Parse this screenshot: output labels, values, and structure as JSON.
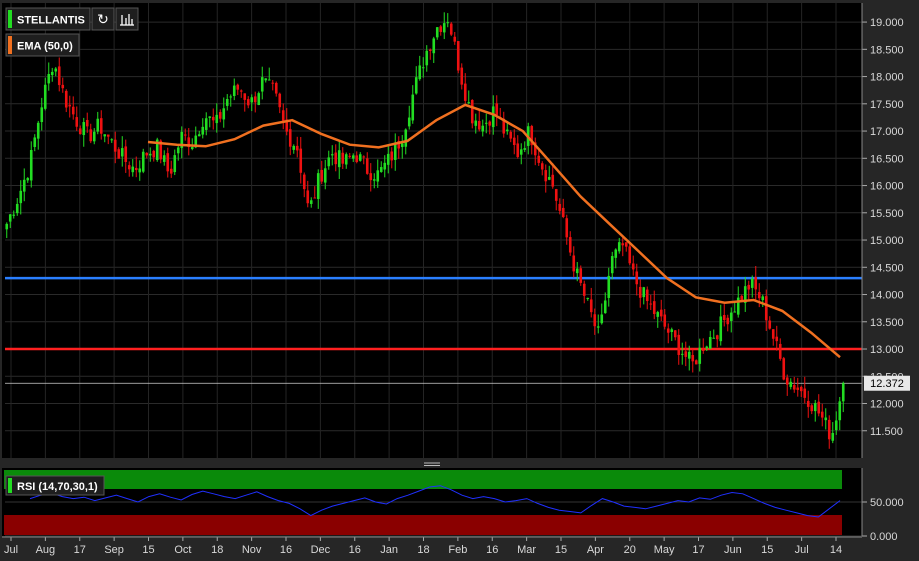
{
  "header": {
    "symbol": "STELLANTIS",
    "refresh_icon": "refresh-icon",
    "chart_type_icon": "bar-chart-icon"
  },
  "indicators": {
    "ema_label": "EMA (50,0)",
    "rsi_label": "RSI (14,70,30,1)"
  },
  "last_price_label": "12.372",
  "colors": {
    "background": "#000000",
    "frame": "#262626",
    "up_candle": "#22dd22",
    "down_candle": "#ee1111",
    "ema_line": "#f07020",
    "resistance_line": "#2a7fff",
    "support_line": "#ff2020",
    "rsi_line": "#2030ff",
    "rsi_overbought_zone": "#0a8a0a",
    "rsi_oversold_zone": "#8a0000"
  },
  "chart_data": [
    {
      "type": "candlestick",
      "title": "STELLANTIS",
      "ylim": [
        11.0,
        19.35
      ],
      "y_ticks": [
        "11.500",
        "12.000",
        "12.500",
        "13.000",
        "13.500",
        "14.000",
        "14.500",
        "15.000",
        "15.500",
        "16.000",
        "16.500",
        "17.000",
        "17.500",
        "18.000",
        "18.500",
        "19.000"
      ],
      "x_ticks": [
        "Jul",
        "Aug",
        "17",
        "Sep",
        "15",
        "Oct",
        "18",
        "Nov",
        "16",
        "Dec",
        "16",
        "Jan",
        "18",
        "Feb",
        "16",
        "Mar",
        "15",
        "Apr",
        "20",
        "May",
        "17",
        "Jun",
        "15",
        "Jul",
        "14"
      ],
      "horizontal_lines": [
        {
          "value": 14.3,
          "color": "#2a7fff"
        },
        {
          "value": 13.0,
          "color": "#ff2020"
        }
      ],
      "last_price": 12.372,
      "close_anchors": [
        15.3,
        15.8,
        16.4,
        17.5,
        18.3,
        17.6,
        17.2,
        16.9,
        17.1,
        16.8,
        16.5,
        16.3,
        16.6,
        16.7,
        16.2,
        16.9,
        16.8,
        17.3,
        17.1,
        17.6,
        17.8,
        17.5,
        17.9,
        17.7,
        17.0,
        16.7,
        15.5,
        16.2,
        16.6,
        16.4,
        16.6,
        16.3,
        16.2,
        16.5,
        16.9,
        17.7,
        18.4,
        18.9,
        19.1,
        18.1,
        17.3,
        17.1,
        17.4,
        16.9,
        16.6,
        17.0,
        16.4,
        16.0,
        15.2,
        14.4,
        13.8,
        13.2,
        14.6,
        14.9,
        14.3,
        13.9,
        13.6,
        13.3,
        13.0,
        12.7,
        13.1,
        13.3,
        13.6,
        13.9,
        14.2,
        13.9,
        13.2,
        12.5,
        12.3,
        12.1,
        11.8,
        11.4,
        12.37
      ],
      "series": [
        {
          "name": "EMA (50,0)",
          "values": [
            16.8,
            16.75,
            16.72,
            16.85,
            17.1,
            17.2,
            16.95,
            16.75,
            16.7,
            16.82,
            17.2,
            17.48,
            17.3,
            17.0,
            16.4,
            15.8,
            15.3,
            14.8,
            14.3,
            13.95,
            13.85,
            13.9,
            13.7,
            13.3,
            12.85
          ]
        }
      ]
    },
    {
      "type": "line",
      "title": "RSI (14,70,30,1)",
      "ylim": [
        0,
        100
      ],
      "y_ticks": [
        "0.000",
        "50.000"
      ],
      "zones": [
        {
          "from": 70,
          "to": 100,
          "color": "#0a8a0a"
        },
        {
          "from": 0,
          "to": 30,
          "color": "#8a0000"
        }
      ],
      "series": [
        {
          "name": "RSI (14,70,30,1)",
          "values": [
            55,
            60,
            63,
            58,
            55,
            57,
            52,
            56,
            60,
            55,
            50,
            58,
            62,
            57,
            53,
            61,
            66,
            62,
            58,
            55,
            60,
            65,
            58,
            52,
            48,
            40,
            30,
            38,
            44,
            48,
            52,
            56,
            50,
            47,
            55,
            60,
            66,
            72,
            74,
            68,
            60,
            55,
            58,
            55,
            50,
            52,
            55,
            48,
            42,
            38,
            36,
            34,
            45,
            55,
            50,
            44,
            42,
            40,
            44,
            48,
            52,
            50,
            56,
            54,
            60,
            64,
            62,
            55,
            48,
            42,
            38,
            34,
            30,
            28,
            40,
            52
          ]
        }
      ]
    }
  ]
}
